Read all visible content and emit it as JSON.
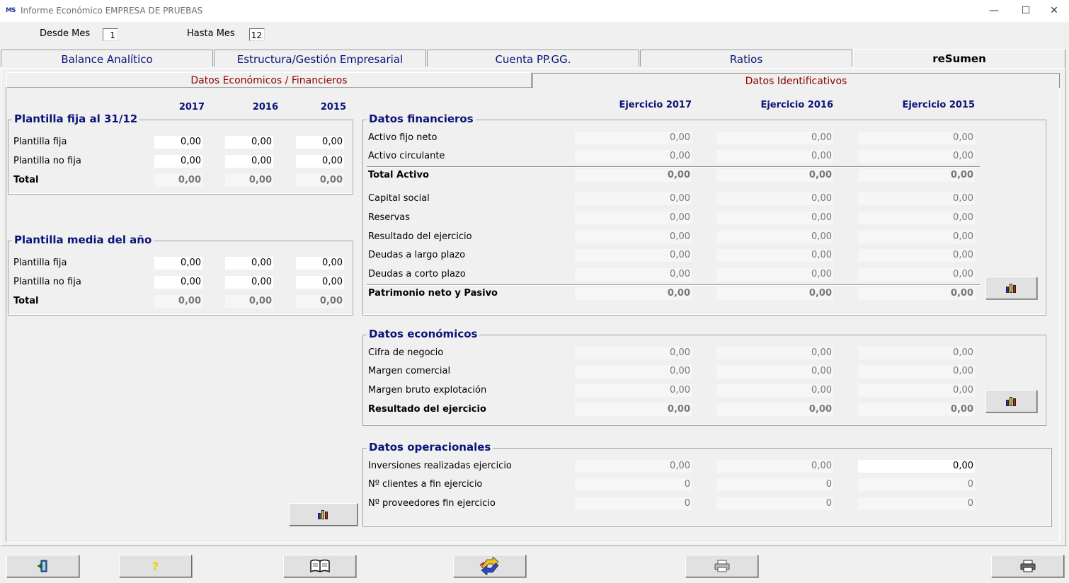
{
  "window": {
    "title": "Informe Económico EMPRESA DE PRUEBAS",
    "icon_text": "MS",
    "minimize": "—",
    "maximize": "☐",
    "close": "✕"
  },
  "filters": {
    "desde_label": "Desde Mes",
    "desde_value": "1",
    "hasta_label": "Hasta Mes",
    "hasta_value": "12"
  },
  "tabs": [
    {
      "label": "Balance Analítico"
    },
    {
      "label": "Estructura/Gestión Empresarial"
    },
    {
      "label": "Cuenta PP.GG."
    },
    {
      "label": "Ratios"
    },
    {
      "label": "reSumen",
      "active": true
    }
  ],
  "subtabs": [
    {
      "label": "Datos Económicos / Financieros",
      "active": true
    },
    {
      "label": "Datos Identificativos"
    }
  ],
  "left": {
    "years": [
      "2017",
      "2016",
      "2015"
    ],
    "plantilla_fija": {
      "title": "Plantilla fija al 31/12",
      "rows": [
        {
          "label": "Plantilla fija",
          "values": [
            "0,00",
            "0,00",
            "0,00"
          ]
        },
        {
          "label": "Plantilla no fija",
          "values": [
            "0,00",
            "0,00",
            "0,00"
          ]
        },
        {
          "label": "Total",
          "values": [
            "0,00",
            "0,00",
            "0,00"
          ]
        }
      ]
    },
    "plantilla_media": {
      "title": "Plantilla media del año",
      "rows": [
        {
          "label": "Plantilla fija",
          "values": [
            "0,00",
            "0,00",
            "0,00"
          ]
        },
        {
          "label": "Plantilla no fija",
          "values": [
            "0,00",
            "0,00",
            "0,00"
          ]
        },
        {
          "label": "Total",
          "values": [
            "0,00",
            "0,00",
            "0,00"
          ]
        }
      ]
    }
  },
  "right": {
    "years": [
      "Ejercicio 2017",
      "Ejercicio 2016",
      "Ejercicio 2015"
    ],
    "financieros": {
      "title": "Datos financieros",
      "rows": [
        {
          "label": "Activo fijo neto",
          "values": [
            "0,00",
            "0,00",
            "0,00"
          ]
        },
        {
          "label": "Activo circulante",
          "values": [
            "0,00",
            "0,00",
            "0,00"
          ]
        },
        {
          "label": "Total Activo",
          "values": [
            "0,00",
            "0,00",
            "0,00"
          ]
        },
        {
          "label": "Capital social",
          "values": [
            "0,00",
            "0,00",
            "0,00"
          ]
        },
        {
          "label": "Reservas",
          "values": [
            "0,00",
            "0,00",
            "0,00"
          ]
        },
        {
          "label": "Resultado del ejercicio",
          "values": [
            "0,00",
            "0,00",
            "0,00"
          ]
        },
        {
          "label": "Deudas a largo plazo",
          "values": [
            "0,00",
            "0,00",
            "0,00"
          ]
        },
        {
          "label": "Deudas a corto plazo",
          "values": [
            "0,00",
            "0,00",
            "0,00"
          ]
        },
        {
          "label": "Patrimonio neto y Pasivo",
          "values": [
            "0,00",
            "0,00",
            "0,00"
          ]
        }
      ]
    },
    "economicos": {
      "title": "Datos económicos",
      "rows": [
        {
          "label": "Cifra de negocio",
          "values": [
            "0,00",
            "0,00",
            "0,00"
          ]
        },
        {
          "label": "Margen comercial",
          "values": [
            "0,00",
            "0,00",
            "0,00"
          ]
        },
        {
          "label": "Margen bruto explotación",
          "values": [
            "0,00",
            "0,00",
            "0,00"
          ]
        },
        {
          "label": "Resultado del ejercicio",
          "values": [
            "0,00",
            "0,00",
            "0,00"
          ]
        }
      ]
    },
    "operacionales": {
      "title": "Datos operacionales",
      "rows": [
        {
          "label": "Inversiones realizadas ejercicio",
          "values": [
            "0,00",
            "0,00",
            "0,00"
          ]
        },
        {
          "label": "Nº clientes a fin ejercicio",
          "values": [
            "0",
            "0",
            "0"
          ]
        },
        {
          "label": "Nº proveedores fin ejercicio",
          "values": [
            "0",
            "0",
            "0"
          ]
        }
      ]
    }
  },
  "toolbar": {
    "help_glyph": "?",
    "book_glyph": "📖",
    "print_glyph": "🖶"
  },
  "colors": {
    "accent_blue": "#0a1478",
    "subtab_red": "#8b0000",
    "face": "#f0f0f0"
  }
}
